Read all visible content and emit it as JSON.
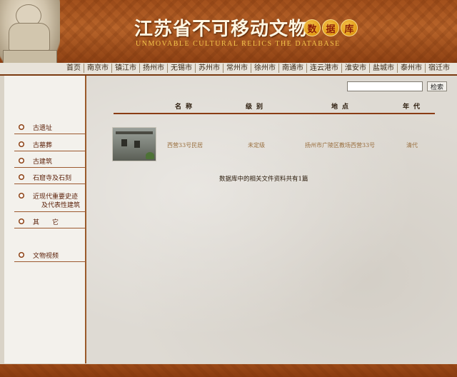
{
  "header": {
    "title": "江苏省不可移动文物",
    "badge_chars": [
      "数",
      "据",
      "库"
    ],
    "subtitle": "UNMOVABLE CULTURAL RELICS THE DATABASE"
  },
  "nav": {
    "items": [
      "首页",
      "南京市",
      "镇江市",
      "扬州市",
      "无锡市",
      "苏州市",
      "常州市",
      "徐州市",
      "南通市",
      "连云港市",
      "淮安市",
      "盐城市",
      "泰州市",
      "宿迁市"
    ]
  },
  "sidebar": {
    "items": [
      {
        "label": "古遗址"
      },
      {
        "label": "古墓葬"
      },
      {
        "label": "古建筑"
      },
      {
        "label": "石窟寺及石刻"
      },
      {
        "label": "近现代重要史迹",
        "label2": "及代表性建筑"
      },
      {
        "label": "其　　它"
      },
      {
        "label": "文物视频"
      }
    ]
  },
  "search": {
    "value": "",
    "button_label": "检索"
  },
  "table": {
    "headers": [
      "名称",
      "级别",
      "地点",
      "年代"
    ],
    "rows": [
      {
        "name": "西营33号民居",
        "level": "未定级",
        "location": "扬州市广陵区教场西营33号",
        "era": "清代",
        "thumbnail_icon": "old-house-photo"
      }
    ]
  },
  "summary": "数据库中的相关文件资料共有1篇",
  "colors": {
    "brand": "#a2501c",
    "accent": "#8a3c14",
    "row_text": "#9a7040"
  }
}
